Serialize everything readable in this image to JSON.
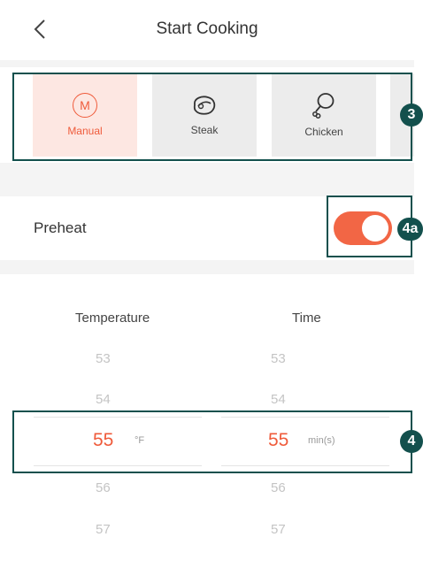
{
  "header": {
    "title": "Start Cooking",
    "back_icon": "chevron-left-icon"
  },
  "modes": [
    {
      "label": "Manual",
      "icon": "M",
      "active": true
    },
    {
      "label": "Steak",
      "icon": "steak-icon",
      "active": false
    },
    {
      "label": "Chicken",
      "icon": "drumstick-icon",
      "active": false
    }
  ],
  "preheat": {
    "label": "Preheat",
    "on": true
  },
  "picker": {
    "temperature": {
      "header": "Temperature",
      "values": [
        "53",
        "54",
        "55",
        "56",
        "57"
      ],
      "selected": "55",
      "unit": "°F"
    },
    "time": {
      "header": "Time",
      "values": [
        "53",
        "54",
        "55",
        "56",
        "57"
      ],
      "selected": "55",
      "unit": "min(s)"
    }
  },
  "callouts": {
    "modes": "3",
    "preheat": "4a",
    "picker": "4"
  },
  "colors": {
    "accent": "#ef5b3b",
    "toggle": "#f26645",
    "callout": "#13504d"
  }
}
